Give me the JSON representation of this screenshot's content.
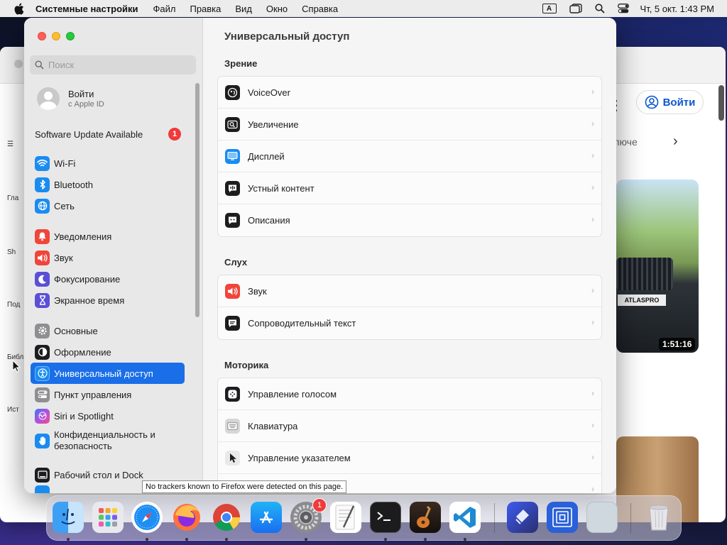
{
  "menubar": {
    "app_name": "Системные настройки",
    "menus": [
      "Файл",
      "Правка",
      "Вид",
      "Окно",
      "Справка"
    ],
    "input_indicator": "A",
    "clock": "Чт, 5 окт.  1:43 PM"
  },
  "background_window": {
    "login_label": "Войти",
    "filter_text": "ключе",
    "video_duration": "1:51:16",
    "plate_text": "ATLASPRO",
    "sidebar_labels": [
      "Гла",
      "Sh",
      "Под",
      "Библ",
      "Ист"
    ]
  },
  "settings": {
    "search_placeholder": "Поиск",
    "account": {
      "title": "Войти",
      "subtitle": "с Apple ID"
    },
    "software_update": {
      "label": "Software Update Available",
      "badge": "1"
    },
    "sidebar_items": [
      {
        "label": "Wi-Fi",
        "icon": "wifi-icon",
        "color": "#1a8cf0"
      },
      {
        "label": "Bluetooth",
        "icon": "bluetooth-icon",
        "color": "#1a8cf0"
      },
      {
        "label": "Сеть",
        "icon": "network-icon",
        "color": "#1a8cf0"
      },
      {
        "label": "Уведомления",
        "icon": "notifications-icon",
        "color": "#f0453a"
      },
      {
        "label": "Звук",
        "icon": "sound-icon",
        "color": "#f0453a"
      },
      {
        "label": "Фокусирование",
        "icon": "focus-icon",
        "color": "#5b4fd6"
      },
      {
        "label": "Экранное время",
        "icon": "screen-time-icon",
        "color": "#5b4fd6"
      },
      {
        "label": "Основные",
        "icon": "general-icon",
        "color": "#8e8e93"
      },
      {
        "label": "Оформление",
        "icon": "appearance-icon",
        "color": "#1d1d1f"
      },
      {
        "label": "Универсальный доступ",
        "icon": "accessibility-icon",
        "color": "#1a8cf0",
        "selected": true
      },
      {
        "label": "Пункт управления",
        "icon": "control-center-icon",
        "color": "#8e8e93"
      },
      {
        "label": "Siri и Spotlight",
        "icon": "siri-icon",
        "color": "#b14fe0"
      },
      {
        "label": "Конфиденциальность и безопасность",
        "icon": "privacy-icon",
        "color": "#1a8cf0"
      },
      {
        "label": "Рабочий стол и Dock",
        "icon": "desktop-dock-icon",
        "color": "#1d1d1f"
      }
    ],
    "content": {
      "title": "Универсальный доступ",
      "sections": [
        {
          "title": "Зрение",
          "rows": [
            {
              "label": "VoiceOver",
              "icon": "voiceover-icon"
            },
            {
              "label": "Увеличение",
              "icon": "zoom-icon"
            },
            {
              "label": "Дисплей",
              "icon": "display-icon"
            },
            {
              "label": "Устный контент",
              "icon": "spoken-content-icon"
            },
            {
              "label": "Описания",
              "icon": "descriptions-icon"
            }
          ]
        },
        {
          "title": "Слух",
          "rows": [
            {
              "label": "Звук",
              "icon": "audio-icon"
            },
            {
              "label": "Сопроводительный текст",
              "icon": "captions-icon"
            }
          ]
        },
        {
          "title": "Моторика",
          "rows": [
            {
              "label": "Управление голосом",
              "icon": "voice-control-icon"
            },
            {
              "label": "Клавиатура",
              "icon": "keyboard-icon"
            },
            {
              "label": "Управление указателем",
              "icon": "pointer-control-icon"
            },
            {
              "label": "",
              "icon": "switch-control-icon"
            }
          ]
        }
      ]
    }
  },
  "tooltip": "No trackers known to Firefox were detected on this page.",
  "dock": {
    "badge": "1",
    "apps": [
      "finder",
      "launchpad",
      "safari",
      "firefox",
      "chrome",
      "app-store",
      "system-settings",
      "textedit",
      "terminal",
      "garageband",
      "vscode",
      "linear",
      "screen-sharing",
      "preview",
      "trash"
    ]
  }
}
